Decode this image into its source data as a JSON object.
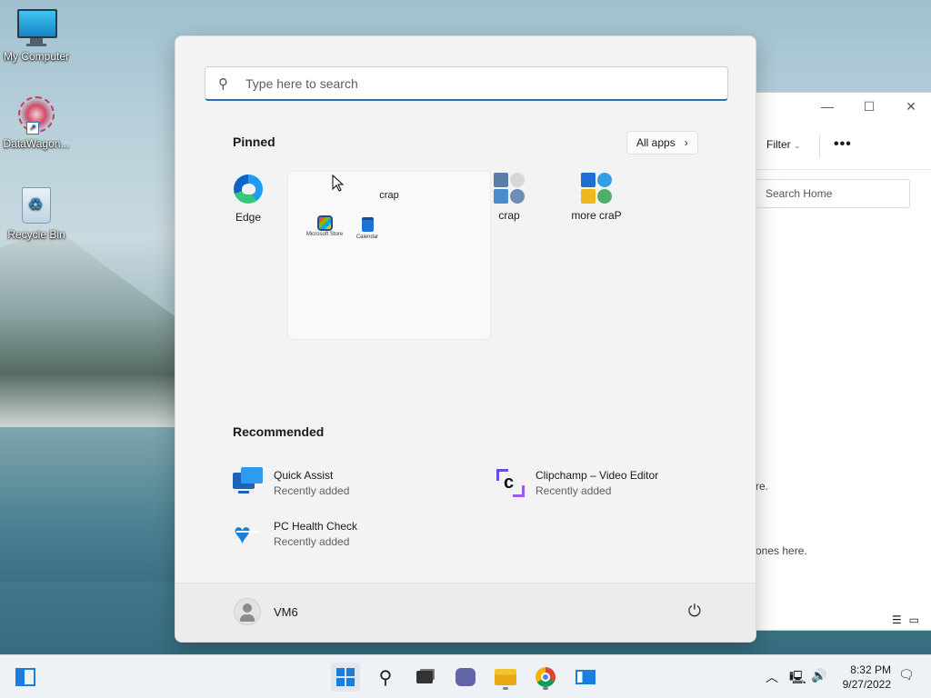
{
  "desktop": {
    "icons": [
      {
        "label": "My Computer"
      },
      {
        "label": "DataWagon..."
      },
      {
        "label": "Recycle Bin"
      }
    ]
  },
  "explorer": {
    "filter_label": "Filter",
    "more_label": "•••",
    "search_placeholder": "Search Home",
    "text_fragment_1": "re.",
    "text_fragment_2": "ones here."
  },
  "start_menu": {
    "search_placeholder": "Type here to search",
    "pinned_title": "Pinned",
    "all_apps_label": "All apps",
    "pinned_apps": [
      {
        "label": "Edge",
        "icon": "edge-icon"
      },
      {
        "label": "crap",
        "icon": "folder-grid-icon"
      },
      {
        "label": "more craP",
        "icon": "folder-grid-icon"
      }
    ],
    "open_folder": {
      "title": "crap",
      "apps": [
        {
          "label": "Microsoft Store"
        },
        {
          "label": "Calendar"
        }
      ]
    },
    "recommended_title": "Recommended",
    "recommended": [
      {
        "name": "Quick Assist",
        "sub": "Recently added"
      },
      {
        "name": "Clipchamp – Video Editor",
        "sub": "Recently added"
      },
      {
        "name": "PC Health Check",
        "sub": "Recently added"
      }
    ],
    "user_name": "VM6"
  },
  "taskbar": {
    "time": "8:32 PM",
    "date": "9/27/2022"
  },
  "colors": {
    "accent": "#1a7de0",
    "menu_bg": "#f3f3f3",
    "taskbar_bg": "#eef2f6"
  }
}
